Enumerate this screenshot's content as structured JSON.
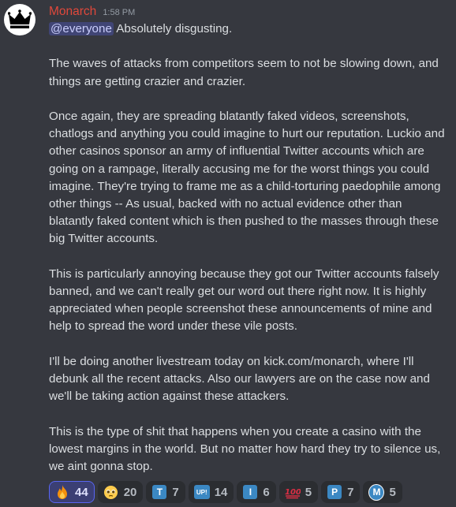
{
  "message": {
    "author": "Monarch",
    "timestamp": "1:58 PM",
    "mention": "@everyone",
    "first_line": " Absolutely disgusting.",
    "paragraphs": [
      "The waves of attacks from competitors seem to not be slowing down, and things are getting crazier and crazier.",
      "Once again, they are spreading blatantly faked videos, screenshots, chatlogs and anything you could imagine to hurt our reputation. Luckio and other casinos sponsor an army of influential Twitter accounts which are going on a rampage, literally accusing me for the worst things you could imagine. They're trying to frame me as a child-torturing paedophile among other things -- As usual, backed with no actual evidence other than blatantly faked content which is then pushed to the masses through these big Twitter accounts.",
      "This is particularly annoying because they got our Twitter accounts falsely banned, and we can't really get our word out there right now. It is highly appreciated when people screenshot these announcements of mine and help to spread the word under these vile posts.",
      "I'll be doing another livestream today on kick.com/monarch, where I'll debunk all the recent attacks. Also our lawyers are on the case now and we'll be taking action against these attackers.",
      "This is the type of shit that happens when you create a casino with the lowest margins in the world. But no matter how hard they try to silence us, we aint gonna stop."
    ]
  },
  "reactions": [
    {
      "icon": "fire-icon",
      "count": "44",
      "active": true
    },
    {
      "icon": "pleading-face-icon",
      "count": "20"
    },
    {
      "icon": "regional-t-icon",
      "letter": "T",
      "color": "#3b88c3",
      "count": "7"
    },
    {
      "icon": "up-button-icon",
      "letter": "UP!",
      "color": "#3b88c3",
      "count": "14"
    },
    {
      "icon": "regional-i-icon",
      "letter": "I",
      "color": "#3b88c3",
      "count": "6"
    },
    {
      "icon": "hundred-points-icon",
      "letter": "💯",
      "color": "#e0483b",
      "count": "5"
    },
    {
      "icon": "regional-p-icon",
      "letter": "P",
      "color": "#3b88c3",
      "count": "7"
    },
    {
      "icon": "circled-m-icon",
      "letter": "M",
      "color": "#3b88c3",
      "count": "5"
    }
  ],
  "colors": {
    "background": "#36383f",
    "username": "#e0483b",
    "mention_bg": "#3c4270",
    "reaction_active_border": "#5865f2"
  }
}
